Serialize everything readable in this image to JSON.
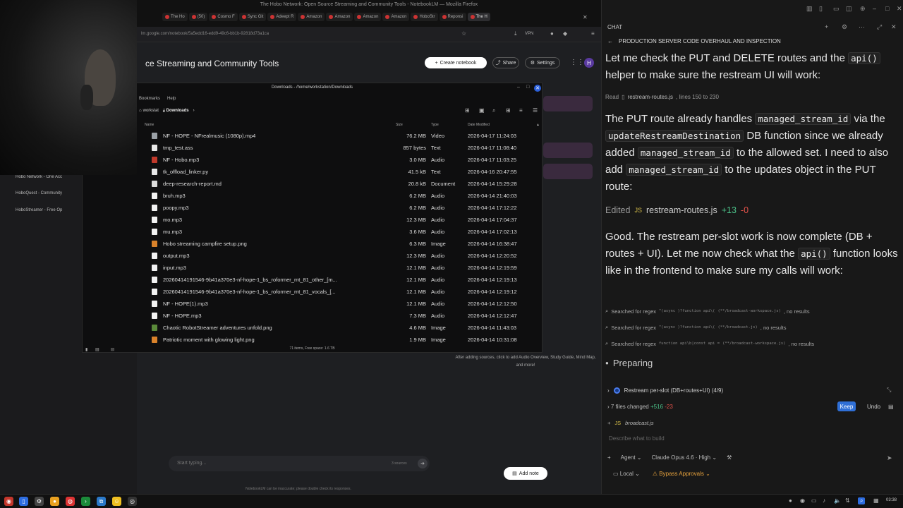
{
  "browser": {
    "window_title": "The Hobo Network: Open Source Streaming and Community Tools - NotebookLM — Mozilla Firefox",
    "tabs": [
      {
        "label": "The Ho"
      },
      {
        "label": "(50) "
      },
      {
        "label": "Cosmo F"
      },
      {
        "label": "Sync Git"
      },
      {
        "label": "Adeept R"
      },
      {
        "label": "Amazon"
      },
      {
        "label": "Amazon"
      },
      {
        "label": "Amazon"
      },
      {
        "label": "Amazon"
      },
      {
        "label": "HoboStr"
      },
      {
        "label": "Reponsi"
      },
      {
        "label": "The H",
        "active": true
      }
    ],
    "url": "lm.google.com/notebook/5a5edd16-edd9-49c6-bb1b-92818d73a1ca",
    "vpn_label": "VPN"
  },
  "notebook": {
    "title": "ce Streaming and Community Tools",
    "create_label": "Create notebook",
    "share_label": "Share",
    "settings_label": "Settings",
    "avatar_letter": "H",
    "chat_placeholder": "Start typing...",
    "sources_count": "3 sources",
    "disclaimer": "NotebookLM can be inaccurate; please double check its responses.",
    "studio_hint": "After adding sources, click to add Audio Overview, Study Guide, Mind Map, and more!",
    "add_note_label": "Add note"
  },
  "sidebar": {
    "items": [
      {
        "label": "Hobo Network - One Acc"
      },
      {
        "label": "HoboQuest - Community"
      },
      {
        "label": "HoboStreamer - Free Op"
      }
    ]
  },
  "file_manager": {
    "title": "Downloads - /home/workstation/Downloads",
    "menu": [
      "Bookmarks",
      "Help"
    ],
    "breadcrumbs": [
      {
        "label": "workstat"
      },
      {
        "label": "Downloads",
        "active": true
      }
    ],
    "columns": {
      "name": "Name",
      "size": "Size",
      "type": "Type",
      "date": "Date Modified"
    },
    "files": [
      {
        "name": "NF - HOPE - NFrealmusic (1080p).mp4",
        "size": "76.2 MB",
        "type": "Video",
        "date": "2026-04-17  11:24:03",
        "icon": "video"
      },
      {
        "name": "tmp_test.ass",
        "size": "857 bytes",
        "type": "Text",
        "date": "2026-04-17  11:08:40",
        "icon": "text"
      },
      {
        "name": "NF - Hobo.mp3",
        "size": "3.0 MB",
        "type": "Audio",
        "date": "2026-04-17  11:03:25",
        "icon": "audio-red"
      },
      {
        "name": "tk_offload_linker.py",
        "size": "41.5 kB",
        "type": "Text",
        "date": "2026-04-16  20:47:55",
        "icon": "text"
      },
      {
        "name": "deep-research-report.md",
        "size": "20.8 kB",
        "type": "Document",
        "date": "2026-04-14  15:29:28",
        "icon": "doc"
      },
      {
        "name": "bruh.mp3",
        "size": "6.2 MB",
        "type": "Audio",
        "date": "2026-04-14  21:40:03",
        "icon": "audio"
      },
      {
        "name": "poopy.mp3",
        "size": "6.2 MB",
        "type": "Audio",
        "date": "2026-04-14  17:12:22",
        "icon": "audio"
      },
      {
        "name": "mo.mp3",
        "size": "12.3 MB",
        "type": "Audio",
        "date": "2026-04-14  17:04:37",
        "icon": "audio"
      },
      {
        "name": "mu.mp3",
        "size": "3.6 MB",
        "type": "Audio",
        "date": "2026-04-14  17:02:13",
        "icon": "audio"
      },
      {
        "name": "Hobo streaming campfire setup.png",
        "size": "6.3 MB",
        "type": "Image",
        "date": "2026-04-14  16:38:47",
        "icon": "image-orange"
      },
      {
        "name": "output.mp3",
        "size": "12.3 MB",
        "type": "Audio",
        "date": "2026-04-14  12:20:52",
        "icon": "audio"
      },
      {
        "name": "input.mp3",
        "size": "12.1 MB",
        "type": "Audio",
        "date": "2026-04-14  12:19:59",
        "icon": "audio"
      },
      {
        "name": "20260414191546-9b41a370e3-nf-hope-1_bs_roformer_mt_81_other_[m...",
        "size": "12.1 MB",
        "type": "Audio",
        "date": "2026-04-14  12:19:13",
        "icon": "audio"
      },
      {
        "name": "20260414191546-9b41a370e3-nf-hope-1_bs_roformer_mt_81_vocals_[...",
        "size": "12.1 MB",
        "type": "Audio",
        "date": "2026-04-14  12:19:12",
        "icon": "audio"
      },
      {
        "name": "NF - HOPE(1).mp3",
        "size": "12.1 MB",
        "type": "Audio",
        "date": "2026-04-14  12:12:50",
        "icon": "audio"
      },
      {
        "name": "NF - HOPE.mp3",
        "size": "7.3 MB",
        "type": "Audio",
        "date": "2026-04-14  12:12:47",
        "icon": "audio"
      },
      {
        "name": "Chaotic RobotStreamer adventures unfold.png",
        "size": "4.6 MB",
        "type": "Image",
        "date": "2026-04-14  11:43:03",
        "icon": "image-green"
      },
      {
        "name": "Patriotic moment with glowing light.png",
        "size": "1.9 MB",
        "type": "Image",
        "date": "2026-04-14  10:31:08",
        "icon": "image-orange"
      }
    ],
    "status": "71 items, Free space: 1.6 TB"
  },
  "ide": {
    "chat_label": "CHAT",
    "session_title": "PRODUCTION SERVER CODE OVERHAUL AND INSPECTION",
    "p1a": "Let me check the PUT and DELETE routes and the",
    "p1code": "api()",
    "p1b": "helper to make sure the restream UI will work:",
    "read_prefix": "Read",
    "read_file": "restream-routes.js",
    "read_suffix": ", lines 150 to 230",
    "p2a": "The PUT route already handles",
    "p2code1": "managed_stream_id",
    "p2b": "via the",
    "p2code2": "updateRestreamDestination",
    "p2c": "DB function since we already added",
    "p2code3": "managed_stream_id",
    "p2d": "to the allowed set. I need to also add",
    "p2code4": "managed_stream_id",
    "p2e": "to the updates object in the PUT route:",
    "edited_label": "Edited",
    "edited_file": "restream-routes.js",
    "edited_add": "+13",
    "edited_del": "-0",
    "p3a": "Good. The restream per-slot work is now complete (DB + routes + UI). Let me now check what the",
    "p3code": "api()",
    "p3b": "function looks like in the frontend to make sure my calls will work:",
    "searches": [
      {
        "prefix": "Searched for regex",
        "regex": "^(async )?function api\\(",
        "file": "(**/broadcast-workspace.js)",
        "result": ", no results"
      },
      {
        "prefix": "Searched for regex",
        "regex": "^(async )?function api\\(",
        "file": "(**/broadcast.js)",
        "result": ", no results"
      },
      {
        "prefix": "Searched for regex",
        "regex": "function api\\b|const api =",
        "file": "(**/broadcast-workspace.js)",
        "result": ", no results"
      }
    ],
    "preparing": "Preparing",
    "task": "Restream per-slot (DB+routes+UI) (4/9)",
    "changes": "7 files changed",
    "changes_add": "+516",
    "changes_del": "-23",
    "keep_label": "Keep",
    "undo_label": "Undo",
    "file_chip": "broadcast.js",
    "composer_placeholder": "Describe what to build",
    "agent_label": "Agent",
    "model_label": "Claude Opus 4.6 · High",
    "local_label": "Local",
    "bypass_label": "Bypass Approvals"
  },
  "taskbar": {
    "clock": "03:38"
  }
}
